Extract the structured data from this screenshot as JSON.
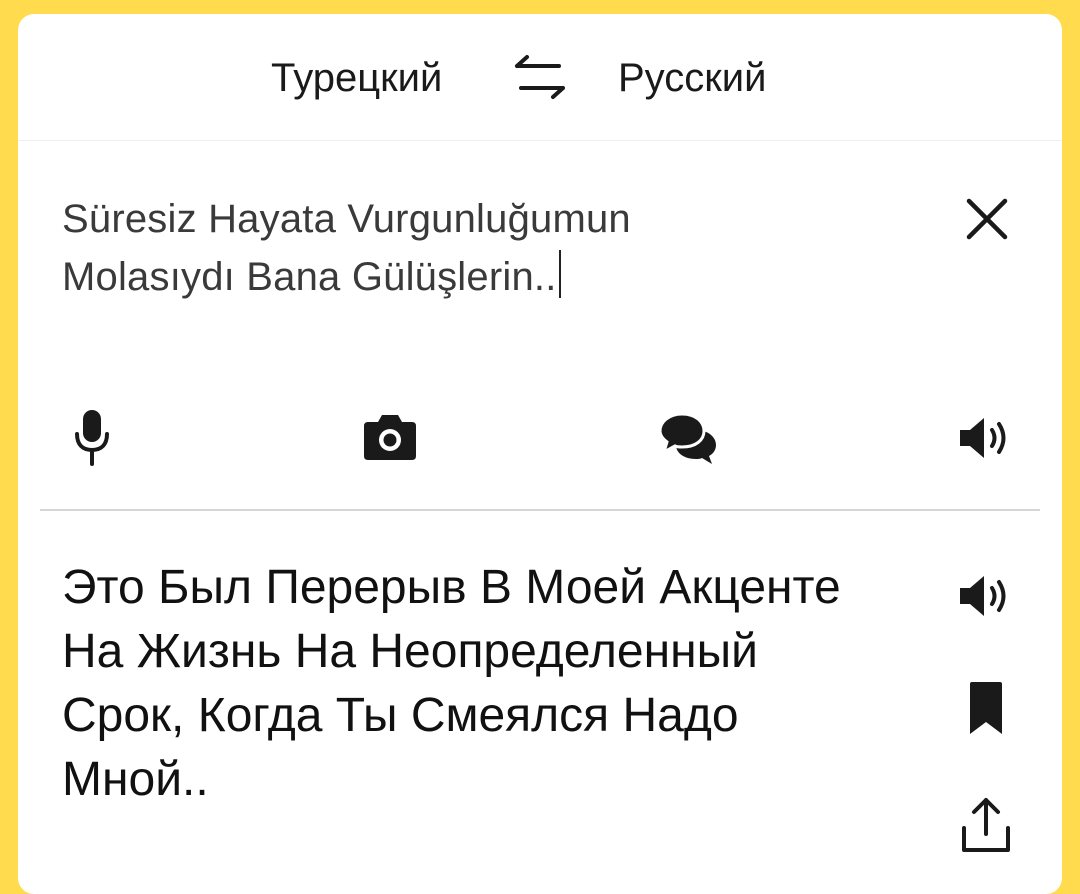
{
  "languages": {
    "source": "Турецкий",
    "target": "Русский"
  },
  "input": {
    "text_line1": "Süresiz Hayata Vurgunluğumun",
    "text_line2": "Molasıydı Bana Gülüşlerin.."
  },
  "output": {
    "text": "Это Был Перерыв В Моей Акценте На Жизнь На Неопределенный Срок, Когда Ты Смеялся Надо Мной.."
  },
  "icons": {
    "swap": "swap-arrows-icon",
    "clear": "close-icon",
    "microphone": "microphone-icon",
    "camera": "camera-icon",
    "dialog": "chat-bubbles-icon",
    "speaker": "speaker-icon",
    "bookmark": "bookmark-icon",
    "share": "share-icon"
  },
  "colors": {
    "background": "#FFDB4D",
    "card": "#FFFFFF",
    "icon": "#1A1A1A"
  }
}
